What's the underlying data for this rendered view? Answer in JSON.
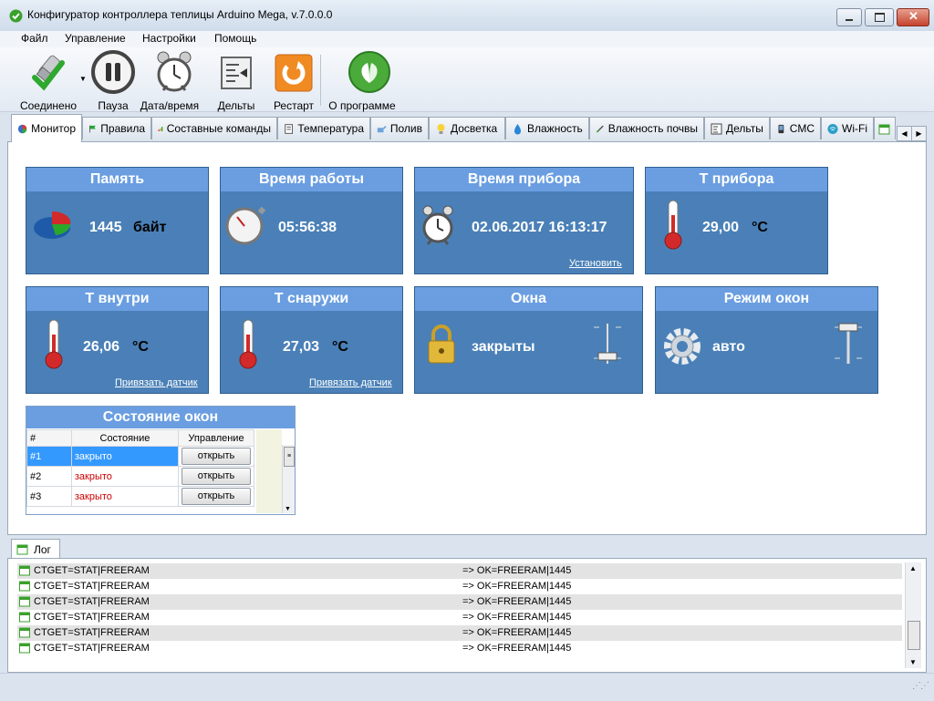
{
  "window": {
    "title": "Конфигуратор контроллера теплицы Arduino Mega, v.7.0.0.0",
    "buttons": [
      "minimize-icon",
      "maximize-icon",
      "close-icon"
    ]
  },
  "menu": [
    "Файл",
    "Управление",
    "Настройки",
    "Помощь"
  ],
  "toolbar": {
    "connected": "Соединено",
    "pause": "Пауза",
    "datetime": "Дата/время",
    "deltas": "Дельты",
    "restart": "Рестарт",
    "about": "О программе"
  },
  "tabs": [
    {
      "label": "Монитор",
      "icon": "monitor-icon",
      "active": true
    },
    {
      "label": "Правила",
      "icon": "flag-icon"
    },
    {
      "label": "Составные команды",
      "icon": "bars-icon"
    },
    {
      "label": "Температура",
      "icon": "thermometer-icon"
    },
    {
      "label": "Полив",
      "icon": "watering-icon"
    },
    {
      "label": "Досветка",
      "icon": "bulb-icon"
    },
    {
      "label": "Влажность",
      "icon": "drop-icon"
    },
    {
      "label": "Влажность почвы",
      "icon": "probe-icon"
    },
    {
      "label": "Дельты",
      "icon": "deltas-icon"
    },
    {
      "label": "СМС",
      "icon": "phone-icon"
    },
    {
      "label": "Wi-Fi",
      "icon": "wifi-icon"
    }
  ],
  "cards": {
    "memory": {
      "title": "Память",
      "value": "1445",
      "unit": "байт"
    },
    "uptime": {
      "title": "Время работы",
      "value": "05:56:38"
    },
    "device_time": {
      "title": "Время прибора",
      "value": "02.06.2017 16:13:17",
      "link": "Установить"
    },
    "device_temp": {
      "title": "Т прибора",
      "value": "29,00",
      "unit": "°C"
    },
    "temp_in": {
      "title": "Т внутри",
      "value": "26,06",
      "unit": "°C",
      "link": "Привязать датчик"
    },
    "temp_out": {
      "title": "Т снаружи",
      "value": "27,03",
      "unit": "°C",
      "link": "Привязать датчик"
    },
    "windows": {
      "title": "Окна",
      "value": "закрыты"
    },
    "window_mode": {
      "title": "Режим окон",
      "value": "авто"
    }
  },
  "window_state": {
    "title": "Состояние окон",
    "columns": [
      "#",
      "Состояние",
      "Управление"
    ],
    "rows": [
      {
        "num": "#1",
        "state": "закрыто",
        "action": "открыть"
      },
      {
        "num": "#2",
        "state": "закрыто",
        "action": "открыть"
      },
      {
        "num": "#3",
        "state": "закрыто",
        "action": "открыть"
      }
    ]
  },
  "log": {
    "tab": "Лог",
    "rows": [
      {
        "cmd": "CTGET=STAT|FREERAM",
        "resp": "=> OK=FREERAM|1445"
      },
      {
        "cmd": "CTGET=STAT|FREERAM",
        "resp": "=> OK=FREERAM|1445"
      },
      {
        "cmd": "CTGET=STAT|FREERAM",
        "resp": "=> OK=FREERAM|1445"
      },
      {
        "cmd": "CTGET=STAT|FREERAM",
        "resp": "=> OK=FREERAM|1445"
      },
      {
        "cmd": "CTGET=STAT|FREERAM",
        "resp": "=> OK=FREERAM|1445"
      },
      {
        "cmd": "CTGET=STAT|FREERAM",
        "resp": "=> OK=FREERAM|1445"
      }
    ]
  },
  "colors": {
    "card_bg": "#4a80b7",
    "card_header": "#6a9ee1",
    "closed_red": "#cc0000",
    "selected_row": "#3399ff"
  }
}
